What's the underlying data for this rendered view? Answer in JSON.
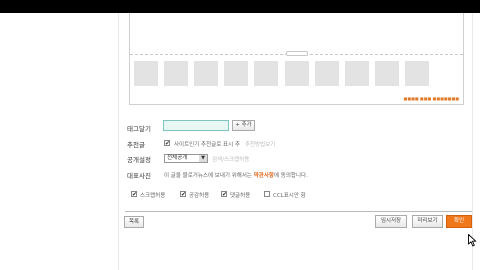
{
  "form": {
    "tag_label": "태그달기",
    "tag_input_value": "",
    "tag_add_button": "+ 추가",
    "recommend_label": "추천글",
    "recommend_option": "사이트인기 추천글로 표시 추",
    "recommend_hint": "추천방법보기",
    "visibility_label": "공개설정",
    "visibility_selected": "전체공개",
    "visibility_hint": "검색/스크랩허용",
    "license_label": "대표사진",
    "license_text_1": "이 글을 블로거뉴스에 보내기 위해서는",
    "license_link": "약관사항",
    "license_text_2": "에 동의합니다.",
    "options": [
      {
        "label": "스크랩허용",
        "checked": true
      },
      {
        "label": "공감허용",
        "checked": true
      },
      {
        "label": "댓글허용",
        "checked": true
      },
      {
        "label": "CCL표시안 함",
        "checked": false
      }
    ]
  },
  "editor": {
    "status_text": "■■■■ ■■■ ■■■■■■■",
    "thumbnail_count": 10
  },
  "footer": {
    "list_button": "목록",
    "save_draft_button": "임시저장",
    "preview_button": "미리보기",
    "publish_button": "확인"
  },
  "colors": {
    "publish": "#f0771a",
    "tag_input_bg": "#e6f7f4",
    "link": "#e0691c"
  },
  "icons": {
    "cursor": "mouse-pointer-icon",
    "dropdown": "chevron-down-icon"
  }
}
